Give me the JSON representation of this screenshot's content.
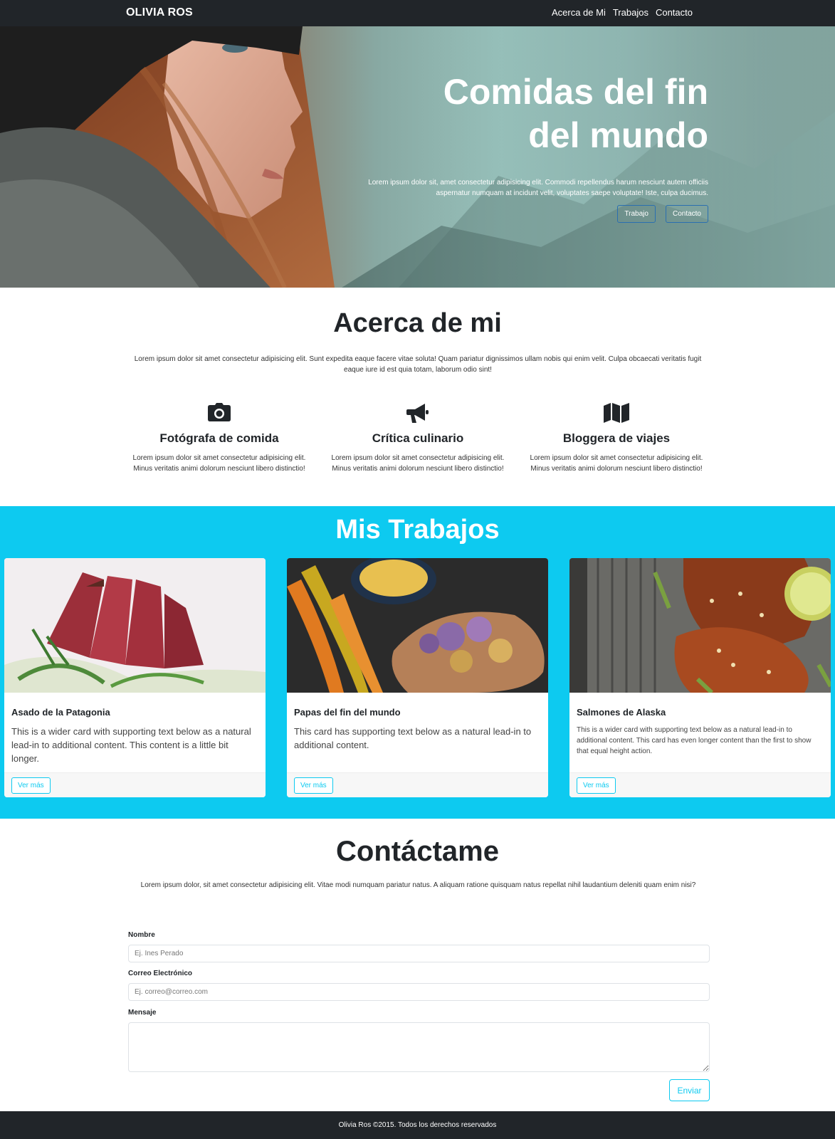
{
  "nav": {
    "brand": "OLIVIA ROS",
    "links": [
      "Acerca de Mi",
      "Trabajos",
      "Contacto"
    ]
  },
  "hero": {
    "title": "Comidas del fin del mundo",
    "text": "Lorem ipsum dolor sit, amet consectetur adipisicing elit. Commodi repellendus harum nesciunt autem officiis aspernatur numquam at incidunt velit, voluptates saepe voluptate! Iste, culpa ducimus.",
    "buttons": [
      "Trabajo",
      "Contacto"
    ],
    "image": "woman-in-knit-hat-photo"
  },
  "about": {
    "title": "Acerca de mi",
    "text": "Lorem ipsum dolor sit amet consectetur adipisicing elit. Sunt expedita eaque facere vitae soluta! Quam pariatur dignissimos ullam nobis qui enim velit. Culpa obcaecati veritatis fugit eaque iure id est quia totam, laborum odio sint!",
    "features": [
      {
        "icon": "camera-icon",
        "title": "Fotógrafa de comida",
        "text": "Lorem ipsum dolor sit amet consectetur adipisicing elit. Minus veritatis animi dolorum nesciunt libero distinctio!"
      },
      {
        "icon": "megaphone-icon",
        "title": "Crítica culinario",
        "text": "Lorem ipsum dolor sit amet consectetur adipisicing elit. Minus veritatis animi dolorum nesciunt libero distinctio!"
      },
      {
        "icon": "map-icon",
        "title": "Bloggera de viajes",
        "text": "Lorem ipsum dolor sit amet consectetur adipisicing elit. Minus veritatis animi dolorum nesciunt libero distinctio!"
      }
    ]
  },
  "works": {
    "title": "Mis Trabajos",
    "background": "#0dcaf0",
    "cards": [
      {
        "image": "seared-tuna-photo",
        "title": "Asado de la Patagonia",
        "text": "This is a wider card with supporting text below as a natural lead-in to additional content. This content is a little bit longer.",
        "button": "Ver más"
      },
      {
        "image": "roasted-vegetables-photo",
        "title": "Papas del fin del mundo",
        "text": "This card has supporting text below as a natural lead-in to additional content.",
        "button": "Ver más"
      },
      {
        "image": "glazed-salmon-photo",
        "title": "Salmones de Alaska",
        "text": "This is a wider card with supporting text below as a natural lead-in to additional content. This card has even longer content than the first to show that equal height action.",
        "button": "Ver más"
      }
    ]
  },
  "contact": {
    "title": "Contáctame",
    "text": "Lorem ipsum dolor, sit amet consectetur adipisicing elit. Vitae modi numquam pariatur natus. A aliquam ratione quisquam natus repellat nihil laudantium deleniti quam enim nisi?",
    "name_label": "Nombre",
    "name_placeholder": "Ej. Ines Perado",
    "email_label": "Correo Electrónico",
    "email_placeholder": "Ej. correo@correo.com",
    "message_label": "Mensaje",
    "submit": "Enviar"
  },
  "footer": {
    "text": "Olivia Ros ©2015. Todos los derechos reservados"
  }
}
